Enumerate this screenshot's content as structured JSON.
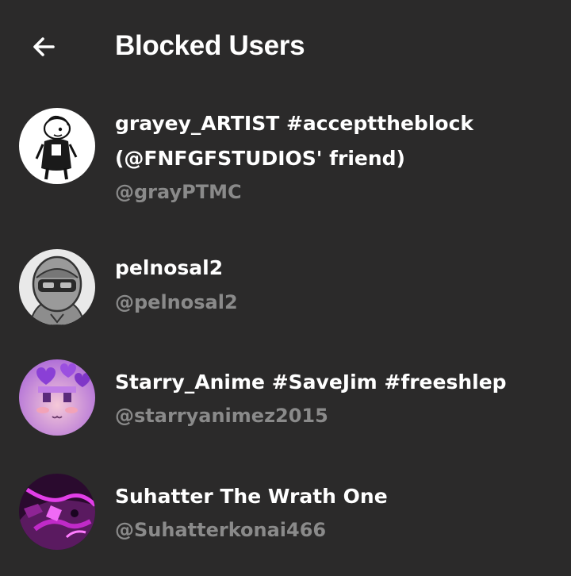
{
  "header": {
    "title": "Blocked Users",
    "back_icon": "arrow-left-icon"
  },
  "blocked_users": [
    {
      "name_line1": "grayey_ARTIST #accepttheblock",
      "name_line2": "(@FNFGFSTUDIOS' friend)",
      "handle": "@grayPTMC"
    },
    {
      "name_line1": "pelnosal2",
      "handle": "@pelnosal2"
    },
    {
      "name_line1": "Starry_Anime #SaveJim #freeshlep",
      "handle": "@starryanimez2015"
    },
    {
      "name_line1": "Suhatter The Wrath One",
      "handle": "@Suhatterkonai466"
    }
  ],
  "colors": {
    "background": "#2b2a2a",
    "primary_text": "#ffffff",
    "secondary_text": "#8a8a8a"
  }
}
